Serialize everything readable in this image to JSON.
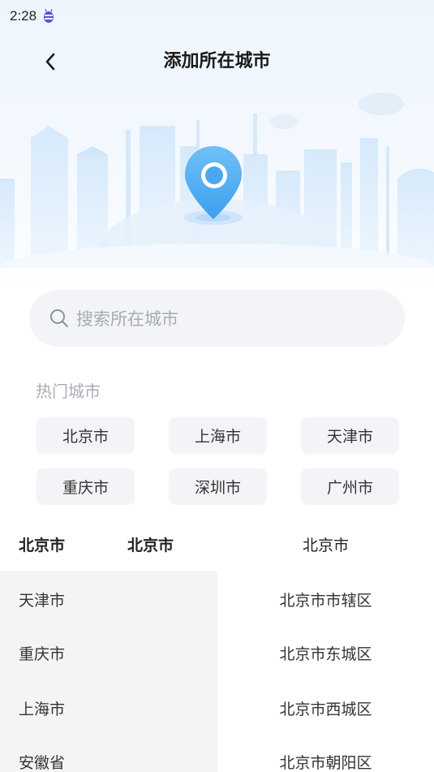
{
  "status_bar": {
    "time": "2:28"
  },
  "header": {
    "title": "添加所在城市"
  },
  "search": {
    "placeholder": "搜索所在城市"
  },
  "hot_cities": {
    "label": "热门城市",
    "items": [
      "北京市",
      "上海市",
      "天津市",
      "重庆市",
      "深圳市",
      "广州市"
    ]
  },
  "columns": {
    "province": "北京市",
    "city": "北京市",
    "district": "北京市"
  },
  "provinces": [
    "天津市",
    "重庆市",
    "上海市",
    "安徽省"
  ],
  "districts": [
    "北京市市辖区",
    "北京市东城区",
    "北京市西城区",
    "北京市朝阳区"
  ],
  "colors": {
    "accent": "#4aa8f0",
    "chip_bg": "#f2f4f7",
    "panel_bg": "#f3f4f6"
  }
}
